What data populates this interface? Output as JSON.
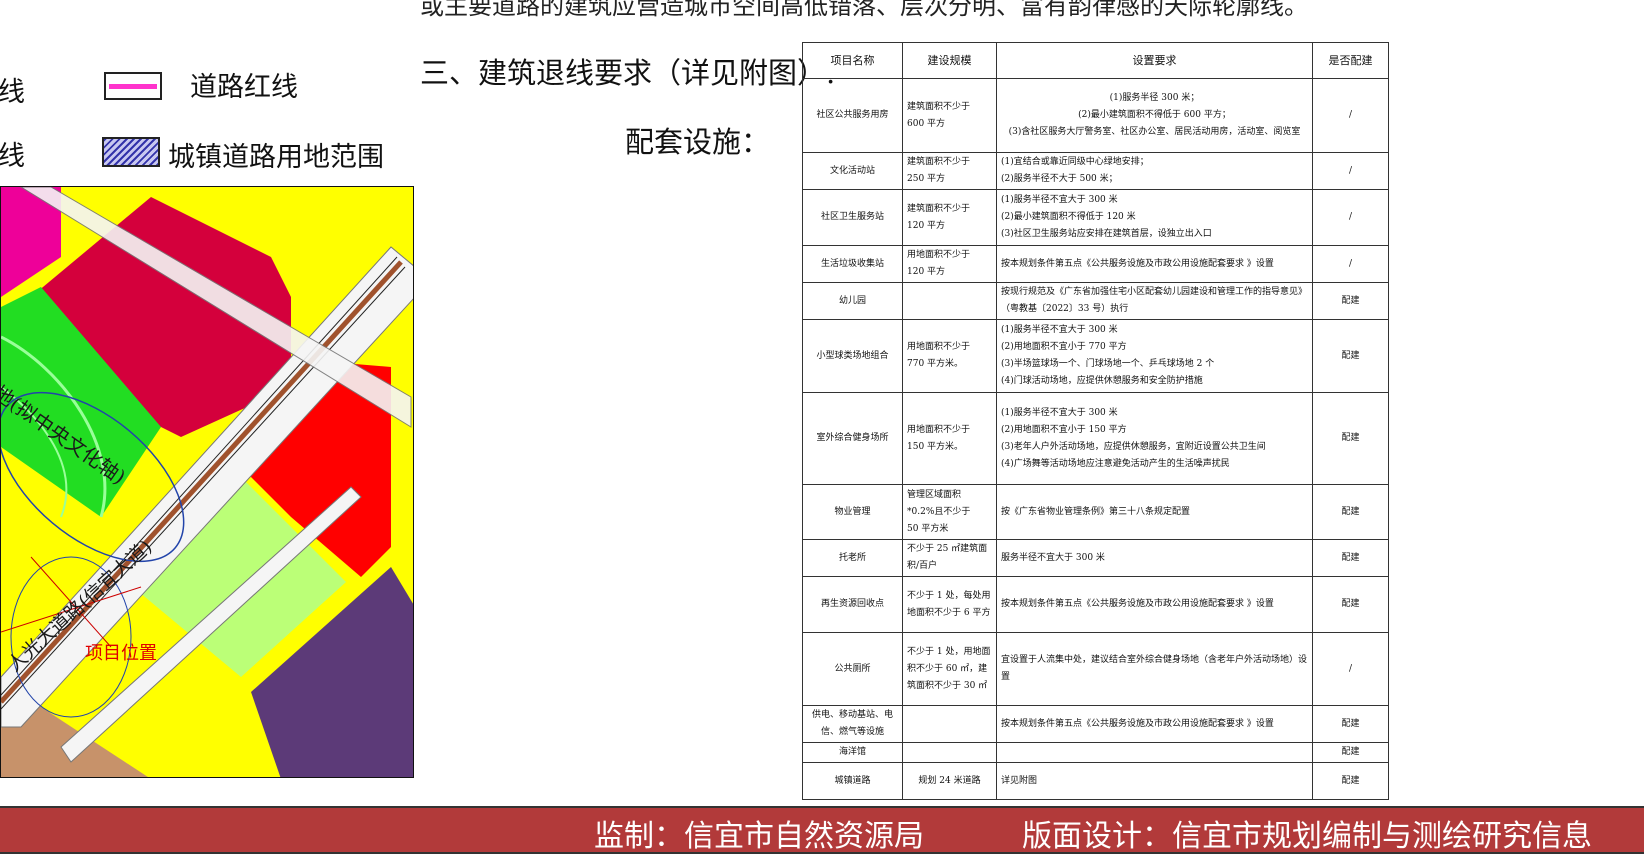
{
  "top_text": "或主要道路的建筑应营造城市空间高低错落、层次分明、富有韵律感的天际轮廓线。",
  "legend": {
    "item1_partial": "线",
    "item1_label": "道路红线",
    "item2_partial": "线",
    "item2_label": "城镇道路用地范围"
  },
  "heading3": "三、建筑退线要求（详见附图）.",
  "subheading": "配套设施：",
  "map": {
    "label_park": "地(拟中央文化轴)",
    "label_road": "人光大道路(信宜大道)",
    "label_project": "项目位置"
  },
  "table": {
    "headers": [
      "项目名称",
      "建设规模",
      "设置要求",
      "是否配建"
    ],
    "rows": [
      {
        "name": "社区公共服务用房",
        "scale": "建筑面积不少于\n600 平方",
        "req": "(1)服务半径 300 米；\n(2)最小建筑面积不得低于 600 平方；\n(3)含社区服务大厅警务室、社区办公室、居民活动用房，活动室、阅览室",
        "built": "/"
      },
      {
        "name": "文化活动站",
        "scale": "建筑面积不少于\n250 平方",
        "req": "(1)宜结合或靠近同级中心绿地安排；\n(2)服务半径不大于 500 米；",
        "built": "/"
      },
      {
        "name": "社区卫生服务站",
        "scale": "建筑面积不少于\n120 平方",
        "req": "(1)服务半径不宜大于 300 米\n(2)最小建筑面积不得低于 120 米\n(3)社区卫生服务站应安排在建筑首层，设独立出入口",
        "built": "/"
      },
      {
        "name": "生活垃圾收集站",
        "scale": "用地面积不少于\n120 平方",
        "req": "按本规划条件第五点《公共服务设施及市政公用设施配套要求 》设置",
        "built": "/"
      },
      {
        "name": "幼儿园",
        "scale": "",
        "req": "按现行规范及《广东省加强住宅小区配套幼儿园建设和管理工作的指导意见》（粤教基〔2022〕33 号）执行",
        "built": "配建"
      },
      {
        "name": "小型球类场地组合",
        "scale": "用地面积不少于\n770 平方米。",
        "req": "(1)服务半径不宜大于 300 米\n(2)用地面积不宜小于 770 平方\n(3)半场篮球场一个、门球场地一个、乒乓球场地 2 个\n(4)门球活动场地，应提供休憩服务和安全防护措施",
        "built": "配建"
      },
      {
        "name": "室外综合健身场所",
        "scale": "用地面积不少于\n150 平方米。",
        "req": "(1)服务半径不宜大于 300 米\n(2)用地面积不宜小于 150 平方\n(3)老年人户外活动场地，应提供休憩服务，宜附近设置公共卫生间\n(4)广场舞等活动场地应注意避免活动产生的生活噪声扰民",
        "built": "配建"
      },
      {
        "name": "物业管理",
        "scale": "管理区域面积\n*0.2%且不少于\n50 平方米",
        "req": "按《广东省物业管理条例》第三十八条规定配置",
        "built": "配建"
      },
      {
        "name": "托老所",
        "scale": "不少于 25 ㎡建筑面积/百户",
        "req": "服务半径不宜大于 300 米",
        "built": "配建"
      },
      {
        "name": "再生资源回收点",
        "scale": "不少于 1 处，每处用地面积不少于 6 平方",
        "req": "按本规划条件第五点《公共服务设施及市政公用设施配套要求 》设置",
        "built": "配建"
      },
      {
        "name": "公共厕所",
        "scale": "不少于 1 处，用地面积不少于 60 ㎡，建筑面积不少于 30 ㎡",
        "req": "宜设置于人流集中处，建议结合室外综合健身场地（含老年户外活动场地）设置",
        "built": "/"
      },
      {
        "name": "供电、移动基站、电信、燃气等设施",
        "scale": "",
        "req": "按本规划条件第五点《公共服务设施及市政公用设施配套要求 》设置",
        "built": "配建"
      },
      {
        "name": "海洋馆",
        "scale": "",
        "req": "",
        "built": "配建"
      },
      {
        "name": "城镇道路",
        "scale": "规划 24 米道路",
        "req": "详见附图",
        "built": "配建"
      }
    ]
  },
  "footer": {
    "left": "监制：信宜市自然资源局",
    "right": "版面设计：信宜市规划编制与测绘研究信息"
  },
  "colors": {
    "footer_bg": "#b23a3a",
    "road_red_line": "#ff33cc",
    "map_yellow": "#ffff00",
    "map_crimson": "#d4003c",
    "map_red": "#ff0000",
    "map_green": "#22dd22",
    "map_lightgreen": "#bbff77",
    "map_purple": "#5c3a78",
    "map_brown": "#c7926a"
  }
}
